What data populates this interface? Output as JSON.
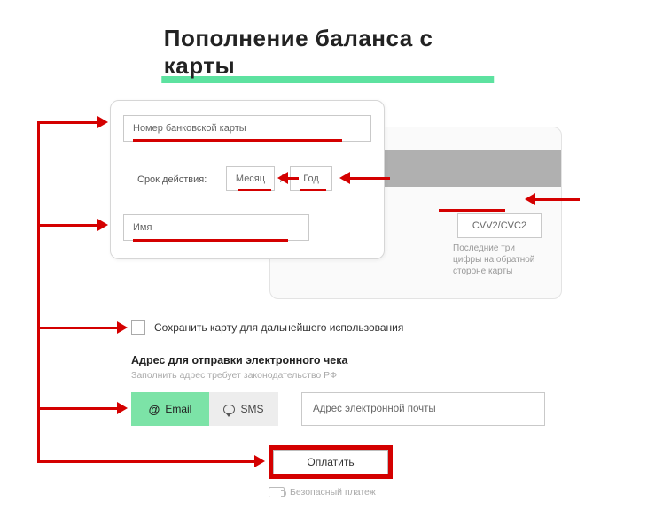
{
  "title": "Пополнение баланса с карты",
  "card": {
    "number_ph": "Номер банковской карты",
    "expiry_label": "Срок действия:",
    "month_ph": "Месяц",
    "year_ph": "Год",
    "name_ph": "Имя",
    "cvv_ph": "CVV2/CVC2",
    "cvv_hint": "Последние три цифры на обратной стороне карты"
  },
  "save_card_label": "Сохранить карту для дальнейшего использования",
  "receipt": {
    "heading": "Адрес для отправки электронного чека",
    "sub": "Заполнить адрес требует законодательство РФ",
    "tab_email": "Email",
    "tab_sms": "SMS",
    "email_ph": "Адрес электронной почты"
  },
  "pay_button": "Оплатить",
  "secure_label": "Безопасный платеж"
}
